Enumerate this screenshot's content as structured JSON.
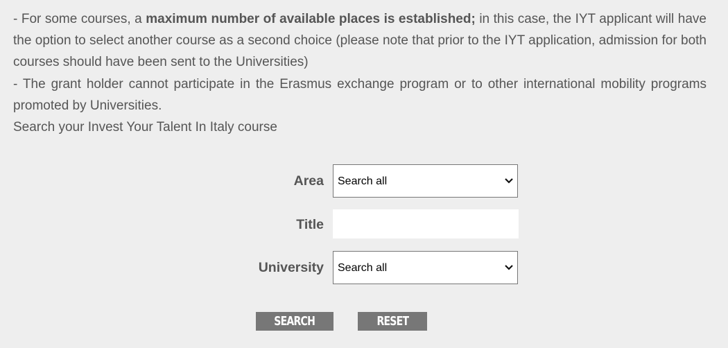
{
  "intro": {
    "line1_prefix": "- For some courses, a ",
    "line1_bold": "maximum number of available places is established;",
    "line1_suffix": " in this case, the IYT applicant will have the option to select another course as a second choice (please note that prior to the IYT application, admission for both courses should have been sent to the Universities)",
    "line2": "- The grant holder cannot participate in the Erasmus exchange program or to other international mobility programs promoted by Universities.",
    "line3": "Search your Invest Your Talent In Italy course"
  },
  "form": {
    "area": {
      "label": "Area",
      "selected": "Search all",
      "icon": "chevron-down-icon"
    },
    "title": {
      "label": "Title",
      "value": "",
      "placeholder": ""
    },
    "university": {
      "label": "University",
      "selected": "Search all",
      "icon": "chevron-down-icon"
    },
    "search_label": "SEARCH",
    "reset_label": "RESET"
  },
  "colors": {
    "background": "#eeeeee",
    "text": "#555555",
    "button_bg": "#777777",
    "button_text": "#ffffff"
  }
}
